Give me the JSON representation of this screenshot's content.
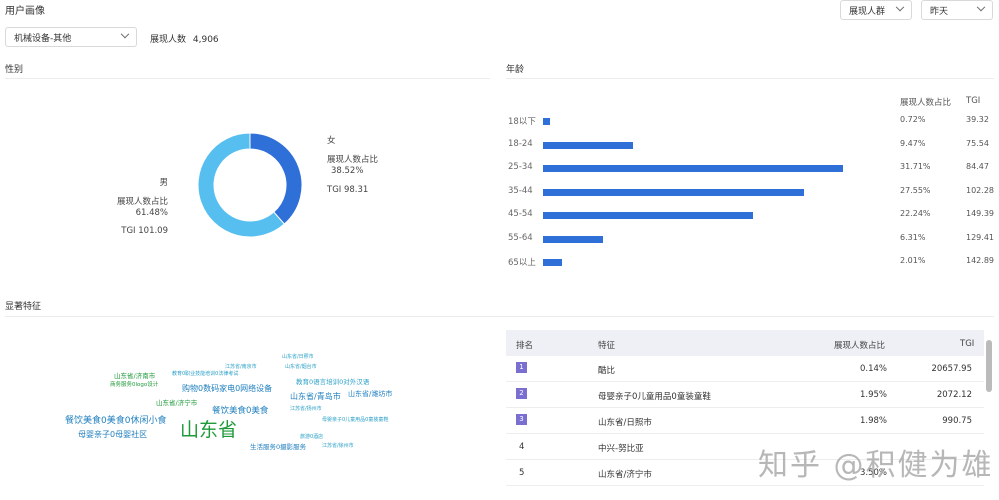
{
  "header": {
    "title": "用户画像",
    "audience_select": "展现人群",
    "time_select": "昨天"
  },
  "filter": {
    "category_select": "机械设备-其他",
    "impression_label": "展现人数",
    "impression_value": "4,906"
  },
  "gender": {
    "title": "性别",
    "female": {
      "name": "女",
      "share_label": "展现人数占比",
      "share": "38.52%",
      "tgi": "TGI 98.31"
    },
    "male": {
      "name": "男",
      "share_label": "展现人数占比",
      "share": "61.48%",
      "tgi": "TGI 101.09"
    },
    "colors": {
      "female": "#2f6fd8",
      "male": "#56bff0"
    }
  },
  "age": {
    "title": "年龄",
    "col_share": "展现人数占比",
    "col_tgi": "TGI",
    "bar_color": "#2f6fd8"
  },
  "chart_data": [
    {
      "type": "pie",
      "labels": [
        "女",
        "男"
      ],
      "values": [
        38.52,
        61.48
      ],
      "tgi": [
        98.31,
        101.09
      ]
    },
    {
      "type": "bar",
      "orientation": "horizontal",
      "categories": [
        "18以下",
        "18-24",
        "25-34",
        "35-44",
        "45-54",
        "55-64",
        "65以上"
      ],
      "values": [
        0.72,
        9.47,
        31.71,
        27.55,
        22.24,
        6.31,
        2.01
      ],
      "value_labels": [
        "0.72%",
        "9.47%",
        "31.71%",
        "27.55%",
        "22.24%",
        "6.31%",
        "2.01%"
      ],
      "tgi": [
        "39.32",
        "75.54",
        "84.47",
        "102.28",
        "149.39",
        "129.41",
        "142.89"
      ]
    }
  ],
  "features": {
    "title": "显著特征",
    "table_headers": {
      "rank": "排名",
      "feature": "特征",
      "share": "展现人数占比",
      "tgi": "TGI"
    },
    "rows": [
      {
        "rank": "1",
        "feature": "酷比",
        "share": "0.14%",
        "tgi": "20657.95"
      },
      {
        "rank": "2",
        "feature": "母婴亲子0儿童用品0童装童鞋",
        "share": "1.95%",
        "tgi": "2072.12"
      },
      {
        "rank": "3",
        "feature": "山东省/日照市",
        "share": "1.98%",
        "tgi": "990.75"
      },
      {
        "rank": "4",
        "feature": "中兴-努比亚",
        "share": "",
        "tgi": ""
      },
      {
        "rank": "5",
        "feature": "山东省/济宁市",
        "share": "3.50%",
        "tgi": ""
      }
    ],
    "wordcloud": [
      {
        "text": "山东省",
        "color": "#1f9a3a"
      },
      {
        "text": "餐饮美食0美食0休闲小食",
        "color": "#1f7fbf"
      },
      {
        "text": "母婴亲子0母婴社区",
        "color": "#1f7fbf"
      },
      {
        "text": "购物0数码家电0网络设备",
        "color": "#1f7fbf"
      },
      {
        "text": "餐饮美食0美食",
        "color": "#1f7fbf"
      },
      {
        "text": "山东省/青岛市",
        "color": "#1f7fbf"
      },
      {
        "text": "山东省/潍坊市",
        "color": "#1f7fbf"
      },
      {
        "text": "山东省/济南市",
        "color": "#1f9a3a"
      },
      {
        "text": "山东省/济宁市",
        "color": "#1f9a3a"
      },
      {
        "text": "生活服务0摄影服务",
        "color": "#1f7fbf"
      },
      {
        "text": "教育0语言培训0对外汉语",
        "color": "#2aa0c8"
      },
      {
        "text": "教育0职业技能培训0法律考试",
        "color": "#2aa0c8"
      },
      {
        "text": "商务服务0logo设计",
        "color": "#1f9a3a"
      },
      {
        "text": "江苏省/南京市",
        "color": "#2aa0c8"
      },
      {
        "text": "江苏省/扬州市",
        "color": "#2aa0c8"
      },
      {
        "text": "山东省/烟台市",
        "color": "#2aa0c8"
      },
      {
        "text": "山东省/日照市",
        "color": "#2aa0c8"
      },
      {
        "text": "母婴亲子0儿童用品0童装童鞋",
        "color": "#2aa0c8"
      },
      {
        "text": "旅游0酒店",
        "color": "#2aa0c8"
      },
      {
        "text": "江苏省/徐州市",
        "color": "#2aa0c8"
      }
    ]
  },
  "watermark": "知乎 @积健为雄"
}
